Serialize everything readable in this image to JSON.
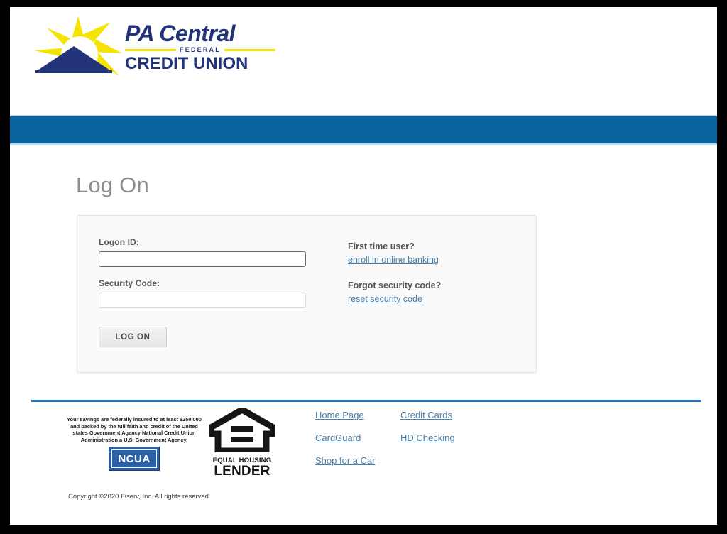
{
  "brand": {
    "logo_icon": "sun-mountain-logo",
    "name_line1": "PA Central",
    "name_middle": "FEDERAL",
    "name_line2": "CREDIT UNION",
    "navy": "#22337a",
    "yellow": "#f5e400"
  },
  "theme": {
    "band_blue": "#0a64a0",
    "band_rule_blue": "#bfdcef",
    "footer_rule_blue": "#1e6fb5",
    "link_blue": "#4a80a8",
    "heading_gray": "#8d8d8d",
    "label_gray": "#56565a",
    "card_bg": "#fafafa",
    "card_border": "#e2e2e2",
    "frame_black": "#000000"
  },
  "main": {
    "page_title": "Log On"
  },
  "form": {
    "logon_id_label": "Logon ID:",
    "logon_id_value": "",
    "logon_id_placeholder": "",
    "security_code_label": "Security Code:",
    "security_code_value": "",
    "security_code_placeholder": "",
    "submit_label": "LOG ON"
  },
  "help": [
    {
      "heading": "First time user?",
      "link_text": "enroll in online banking"
    },
    {
      "heading": "Forgot security code?",
      "link_text": "reset security code"
    }
  ],
  "footer": {
    "ncua_disclosure": "Your savings are federally insured to at least $250,000 and backed by the full faith and credit of the United states Government Agency National Credit Union Administration a U.S. Government Agency.",
    "ncua_badge_text": "NCUA",
    "ncua_badge_icon": "ncua-seal-icon",
    "ehl_icon": "equal-housing-lender-icon",
    "ehl_line1": "EQUAL HOUSING",
    "ehl_line2": "LENDER",
    "links": [
      {
        "label": "Home Page"
      },
      {
        "label": "Credit Cards"
      },
      {
        "label": "CardGuard"
      },
      {
        "label": "HD Checking"
      },
      {
        "label": "Shop for a Car"
      }
    ],
    "copyright": "Copyright ©2020 Fiserv, Inc. All rights reserved."
  }
}
